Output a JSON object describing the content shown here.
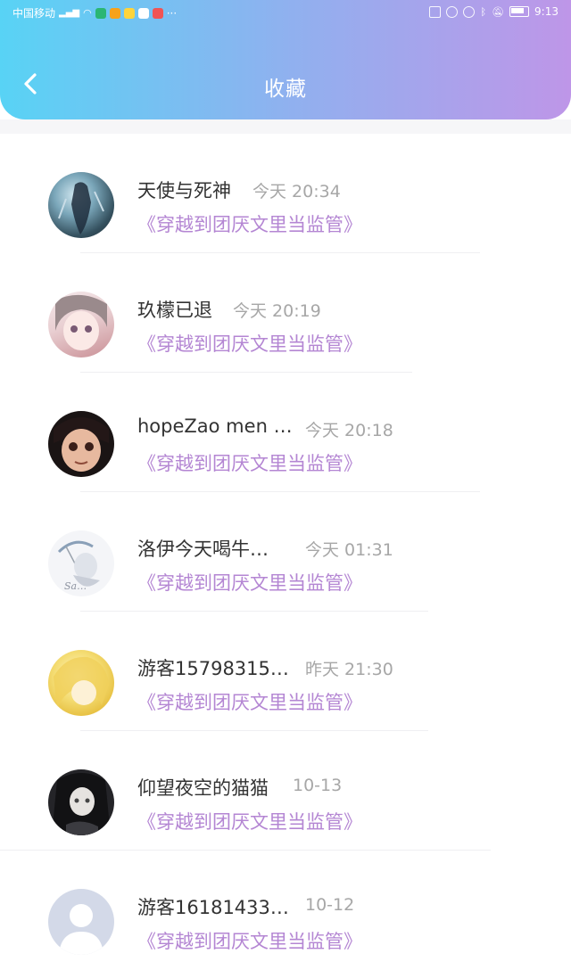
{
  "status": {
    "carrier": "中国移动",
    "time": "9:13"
  },
  "header": {
    "title": "收藏",
    "back_icon": "chevron-left-icon"
  },
  "colors": {
    "accent_gradient": [
      "#58d3f5",
      "#be96e8"
    ],
    "book_link": "#b486d3",
    "timestamp": "#a7a7a7"
  },
  "items": [
    {
      "name": "天使与死神",
      "time": "今天 20:34",
      "book": "《穿越到团厌文里当监管》"
    },
    {
      "name": "玖檬已退",
      "time": "今天 20:19",
      "book": "《穿越到团厌文里当监管》"
    },
    {
      "name": "hopeZao men t…",
      "time": "今天 20:18",
      "book": "《穿越到团厌文里当监管》"
    },
    {
      "name": "洛伊今天喝牛…",
      "time": "今天 01:31",
      "book": "《穿越到团厌文里当监管》"
    },
    {
      "name": "游客15798315…",
      "time": "昨天 21:30",
      "book": "《穿越到团厌文里当监管》"
    },
    {
      "name": "仰望夜空的猫猫",
      "time": "10-13",
      "book": "《穿越到团厌文里当监管》"
    },
    {
      "name": "游客16181433…",
      "time": "10-12",
      "book": "《穿越到团厌文里当监管》"
    }
  ]
}
